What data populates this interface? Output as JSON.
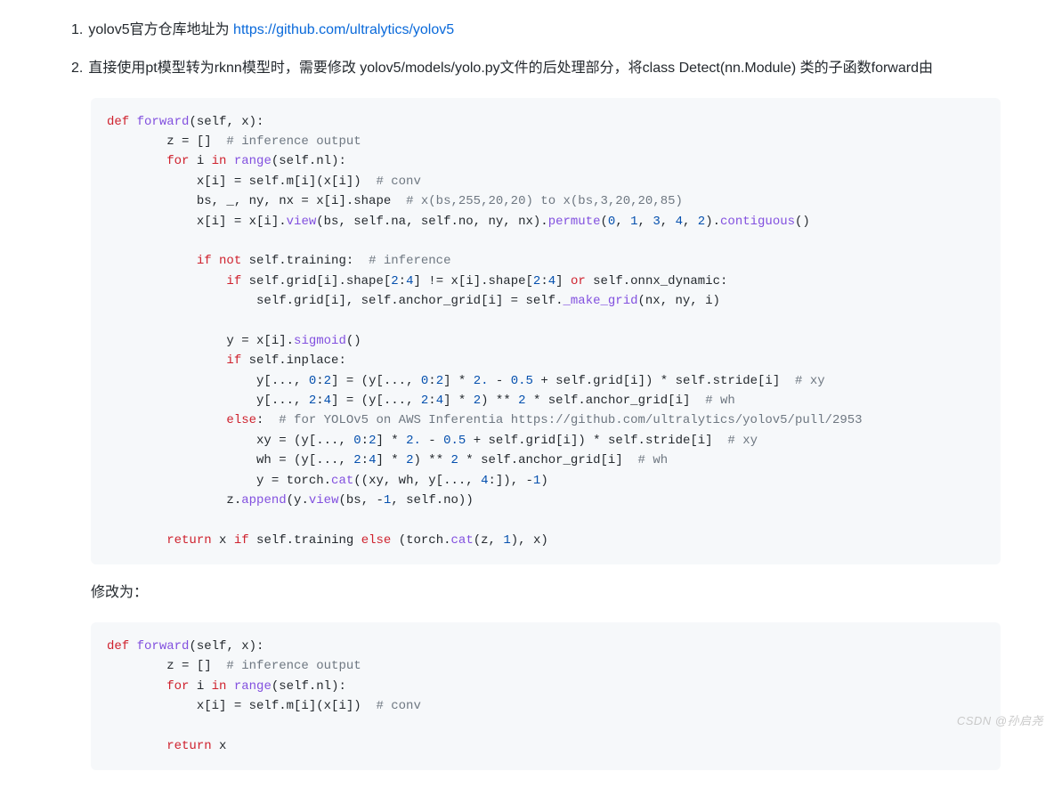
{
  "list": {
    "item1": {
      "num": "1.",
      "text_prefix": "yolov5官方仓库地址为 ",
      "link_text": "https://github.com/ultralytics/yolov5"
    },
    "item2": {
      "num": "2.",
      "text": "直接使用pt模型转为rknn模型时，需要修改 yolov5/models/yolo.py文件的后处理部分，将class Detect(nn.Module) 类的子函数forward由"
    }
  },
  "code1": {
    "l1_def": "def",
    "l1_fn": " forward",
    "l1_rest": "(self, x):",
    "l2_pre": "        z = []  ",
    "l2_cmt": "# inference output",
    "l3_for": "        for",
    "l3_mid": " i ",
    "l3_in": "in",
    "l3_call": " range",
    "l3_rest": "(self.nl):",
    "l4_pre": "            x[i] = self.m[i](x[i])  ",
    "l4_cmt": "# conv",
    "l5_pre": "            bs, _, ny, nx = x[i].shape  ",
    "l5_cmt": "# x(bs,255,20,20) to x(bs,3,20,20,85)",
    "l6_a": "            x[i] = x[i].",
    "l6_view": "view",
    "l6_b": "(bs, self.na, self.no, ny, nx).",
    "l6_perm": "permute",
    "l6_c": "(",
    "l6_n0": "0",
    "l6_c1": ", ",
    "l6_n1": "1",
    "l6_c2": ", ",
    "l6_n3": "3",
    "l6_c3": ", ",
    "l6_n4": "4",
    "l6_c4": ", ",
    "l6_n2": "2",
    "l6_c5": ").",
    "l6_cont": "contiguous",
    "l6_d": "()",
    "l7": "",
    "l8_if": "            if",
    "l8_not": " not",
    "l8_rest": " self.training:  ",
    "l8_cmt": "# inference",
    "l9_if": "                if",
    "l9_a": " self.grid[i].shape[",
    "l9_n2": "2",
    "l9_colon": ":",
    "l9_n4": "4",
    "l9_b": "] != x[i].shape[",
    "l9_n2b": "2",
    "l9_colon2": ":",
    "l9_n4b": "4",
    "l9_c": "] ",
    "l9_or": "or",
    "l9_d": " self.onnx_dynamic:",
    "l10_a": "                    self.grid[i], self.anchor_grid[i] = self.",
    "l10_fn": "_make_grid",
    "l10_b": "(nx, ny, i)",
    "l11": "",
    "l12_a": "                y = x[i].",
    "l12_fn": "sigmoid",
    "l12_b": "()",
    "l13_if": "                if",
    "l13_rest": " self.inplace:",
    "l14_a": "                    y[..., ",
    "l14_n0": "0",
    "l14_colon": ":",
    "l14_n2": "2",
    "l14_b": "] = (y[..., ",
    "l14_n0b": "0",
    "l14_colon2": ":",
    "l14_n2b": "2",
    "l14_c": "] * ",
    "l14_two": "2.",
    "l14_d": " - ",
    "l14_half": "0.5",
    "l14_e": " + self.grid[i]) * self.stride[i]  ",
    "l14_cmt": "# xy",
    "l15_a": "                    y[..., ",
    "l15_n2": "2",
    "l15_colon": ":",
    "l15_n4": "4",
    "l15_b": "] = (y[..., ",
    "l15_n2b": "2",
    "l15_colon2": ":",
    "l15_n4b": "4",
    "l15_c": "] * ",
    "l15_two": "2",
    "l15_d": ") ** ",
    "l15_two2": "2",
    "l15_e": " * self.anchor_grid[i]  ",
    "l15_cmt": "# wh",
    "l16_else": "                else",
    "l16_colon": ":  ",
    "l16_cmt": "# for YOLOv5 on AWS Inferentia https://github.com/ultralytics/yolov5/pull/2953",
    "l17_a": "                    xy = (y[..., ",
    "l17_n0": "0",
    "l17_colon": ":",
    "l17_n2": "2",
    "l17_b": "] * ",
    "l17_two": "2.",
    "l17_c": " - ",
    "l17_half": "0.5",
    "l17_d": " + self.grid[i]) * self.stride[i]  ",
    "l17_cmt": "# xy",
    "l18_a": "                    wh = (y[..., ",
    "l18_n2": "2",
    "l18_colon": ":",
    "l18_n4": "4",
    "l18_b": "] * ",
    "l18_two": "2",
    "l18_c": ") ** ",
    "l18_two2": "2",
    "l18_d": " * self.anchor_grid[i]  ",
    "l18_cmt": "# wh",
    "l19_a": "                    y = torch.",
    "l19_fn": "cat",
    "l19_b": "((xy, wh, y[..., ",
    "l19_n4": "4",
    "l19_c": ":]), -",
    "l19_n1": "1",
    "l19_d": ")",
    "l20_a": "                z.",
    "l20_fn": "append",
    "l20_b": "(y.",
    "l20_fn2": "view",
    "l20_c": "(bs, -",
    "l20_n1": "1",
    "l20_d": ", self.no))",
    "l21": "",
    "l22_return": "        return",
    "l22_a": " x ",
    "l22_if": "if",
    "l22_b": " self.training ",
    "l22_else": "else",
    "l22_c": " (torch.",
    "l22_fn": "cat",
    "l22_d": "(z, ",
    "l22_n1": "1",
    "l22_e": "), x)"
  },
  "mid_text": "修改为：",
  "code2": {
    "l1_def": "def",
    "l1_fn": " forward",
    "l1_rest": "(self, x):",
    "l2_pre": "        z = []  ",
    "l2_cmt": "# inference output",
    "l3_for": "        for",
    "l3_mid": " i ",
    "l3_in": "in",
    "l3_call": " range",
    "l3_rest": "(self.nl):",
    "l4_pre": "            x[i] = self.m[i](x[i])  ",
    "l4_cmt": "# conv",
    "l5": "",
    "l6_return": "        return",
    "l6_rest": " x"
  },
  "watermark": "CSDN @孙启尧"
}
